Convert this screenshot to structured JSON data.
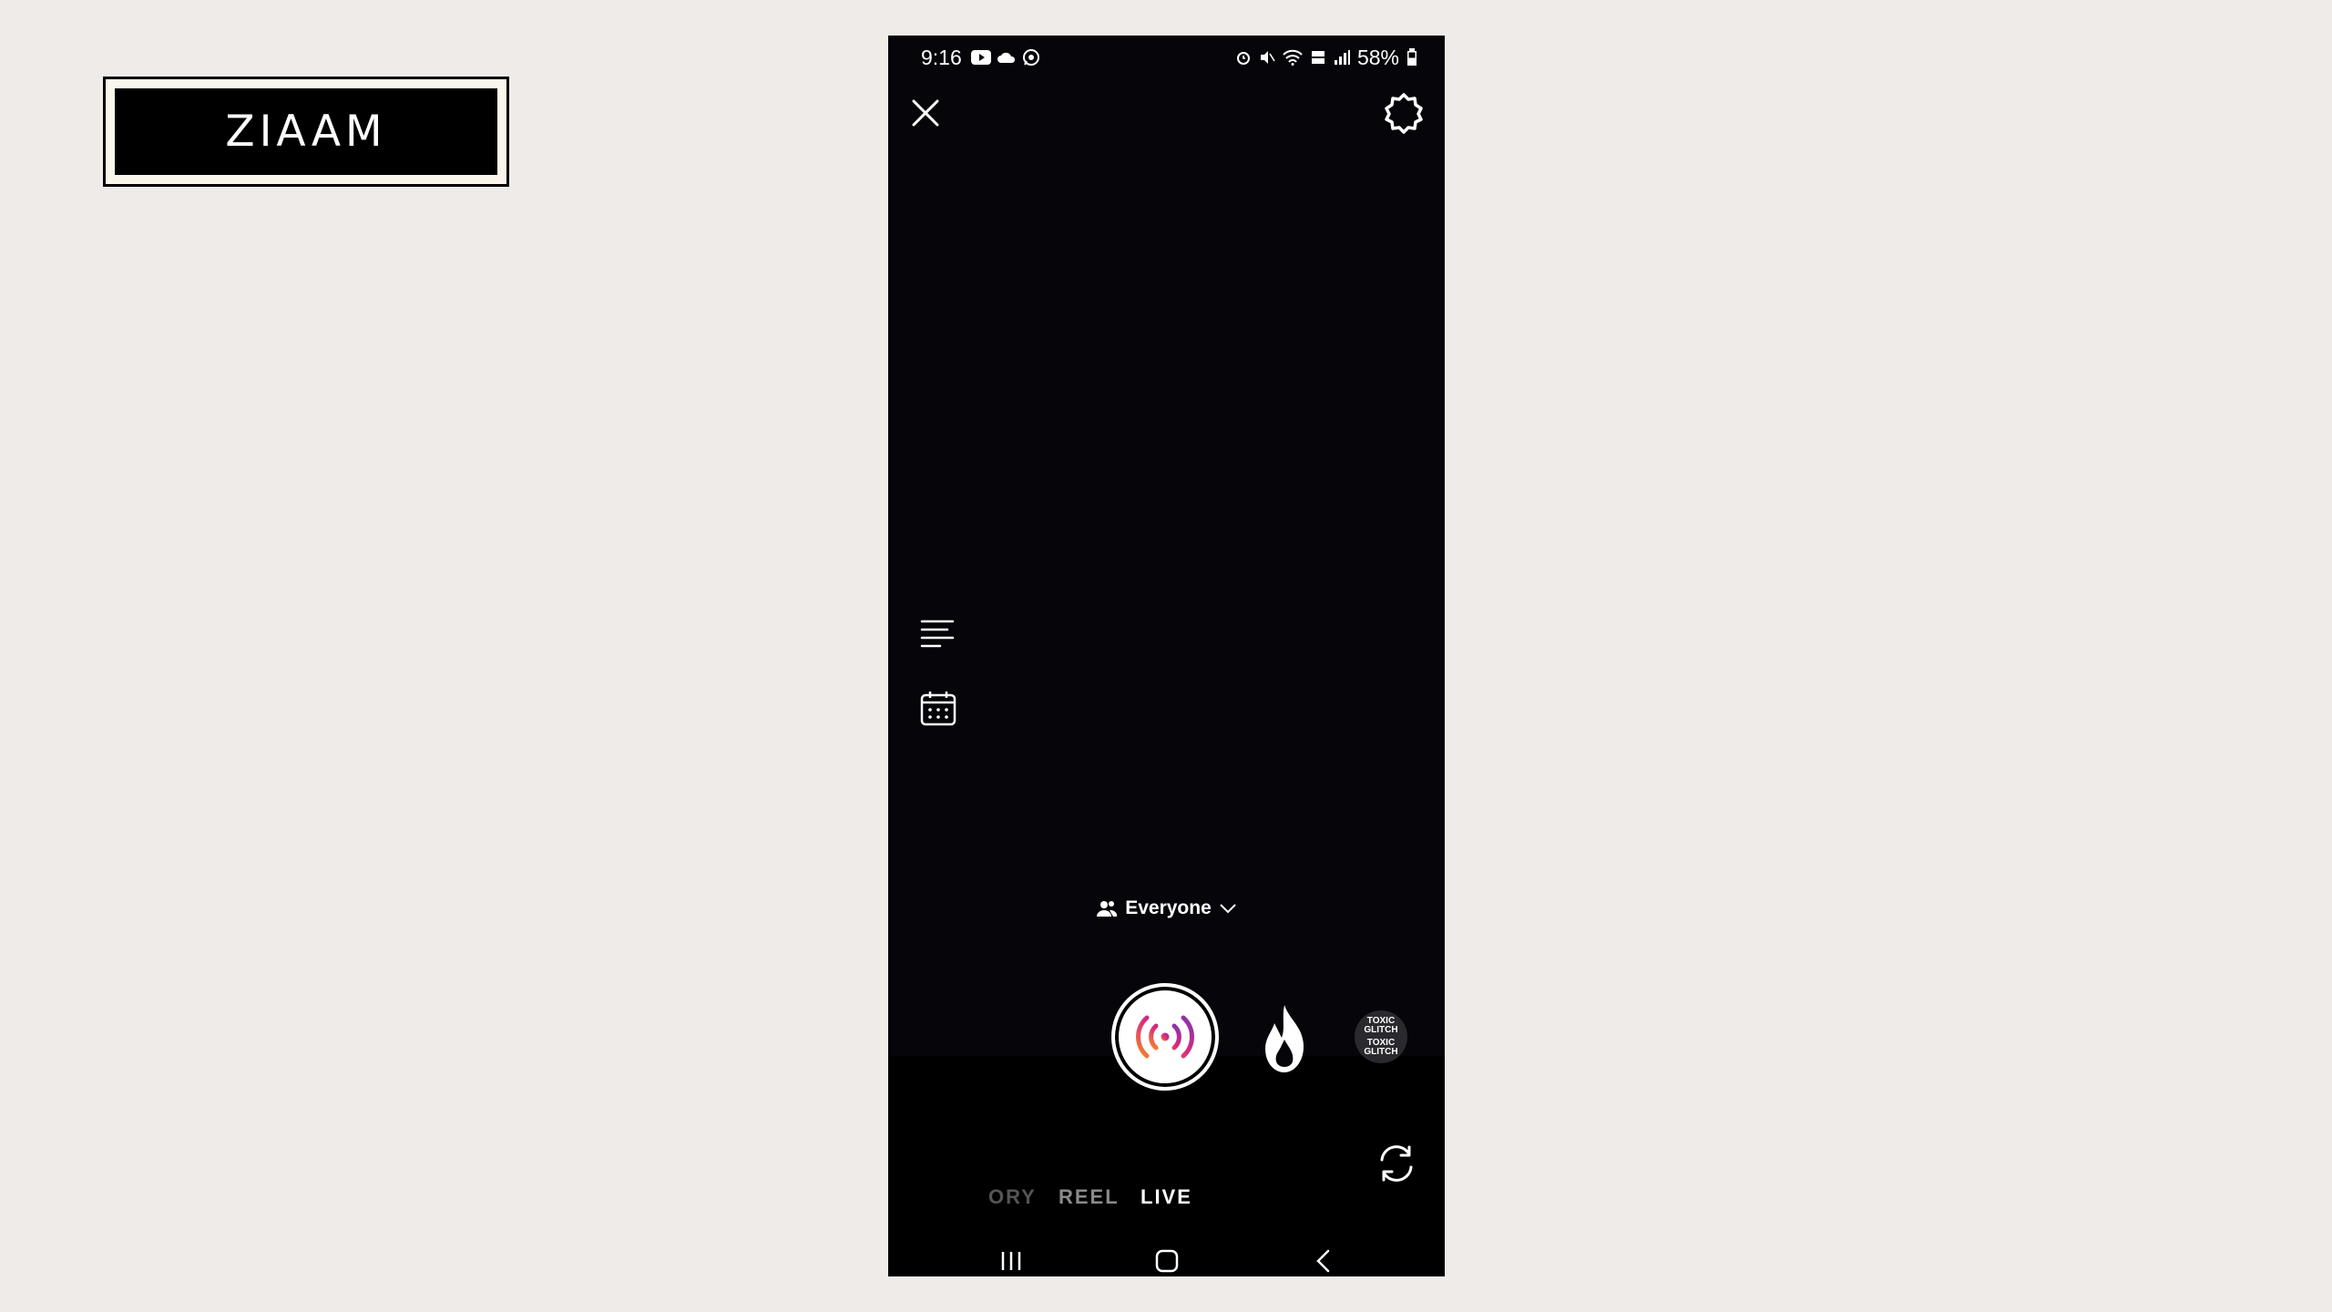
{
  "brand": {
    "logo_text": "ZIAAM"
  },
  "status_bar": {
    "time": "9:16",
    "battery": "58%"
  },
  "camera": {
    "audience_label": "Everyone",
    "effect_labels": [
      "TOXIC",
      "GLITCH",
      "TOXIC",
      "GLITCH"
    ],
    "modes": {
      "story": "ORY",
      "reel": "REEL",
      "live": "LIVE"
    }
  },
  "colors": {
    "page_bg": "#efebe8",
    "phone_bg": "#06060a",
    "accent_gradient": [
      "#f58529",
      "#dd2a7b",
      "#8134af"
    ]
  }
}
